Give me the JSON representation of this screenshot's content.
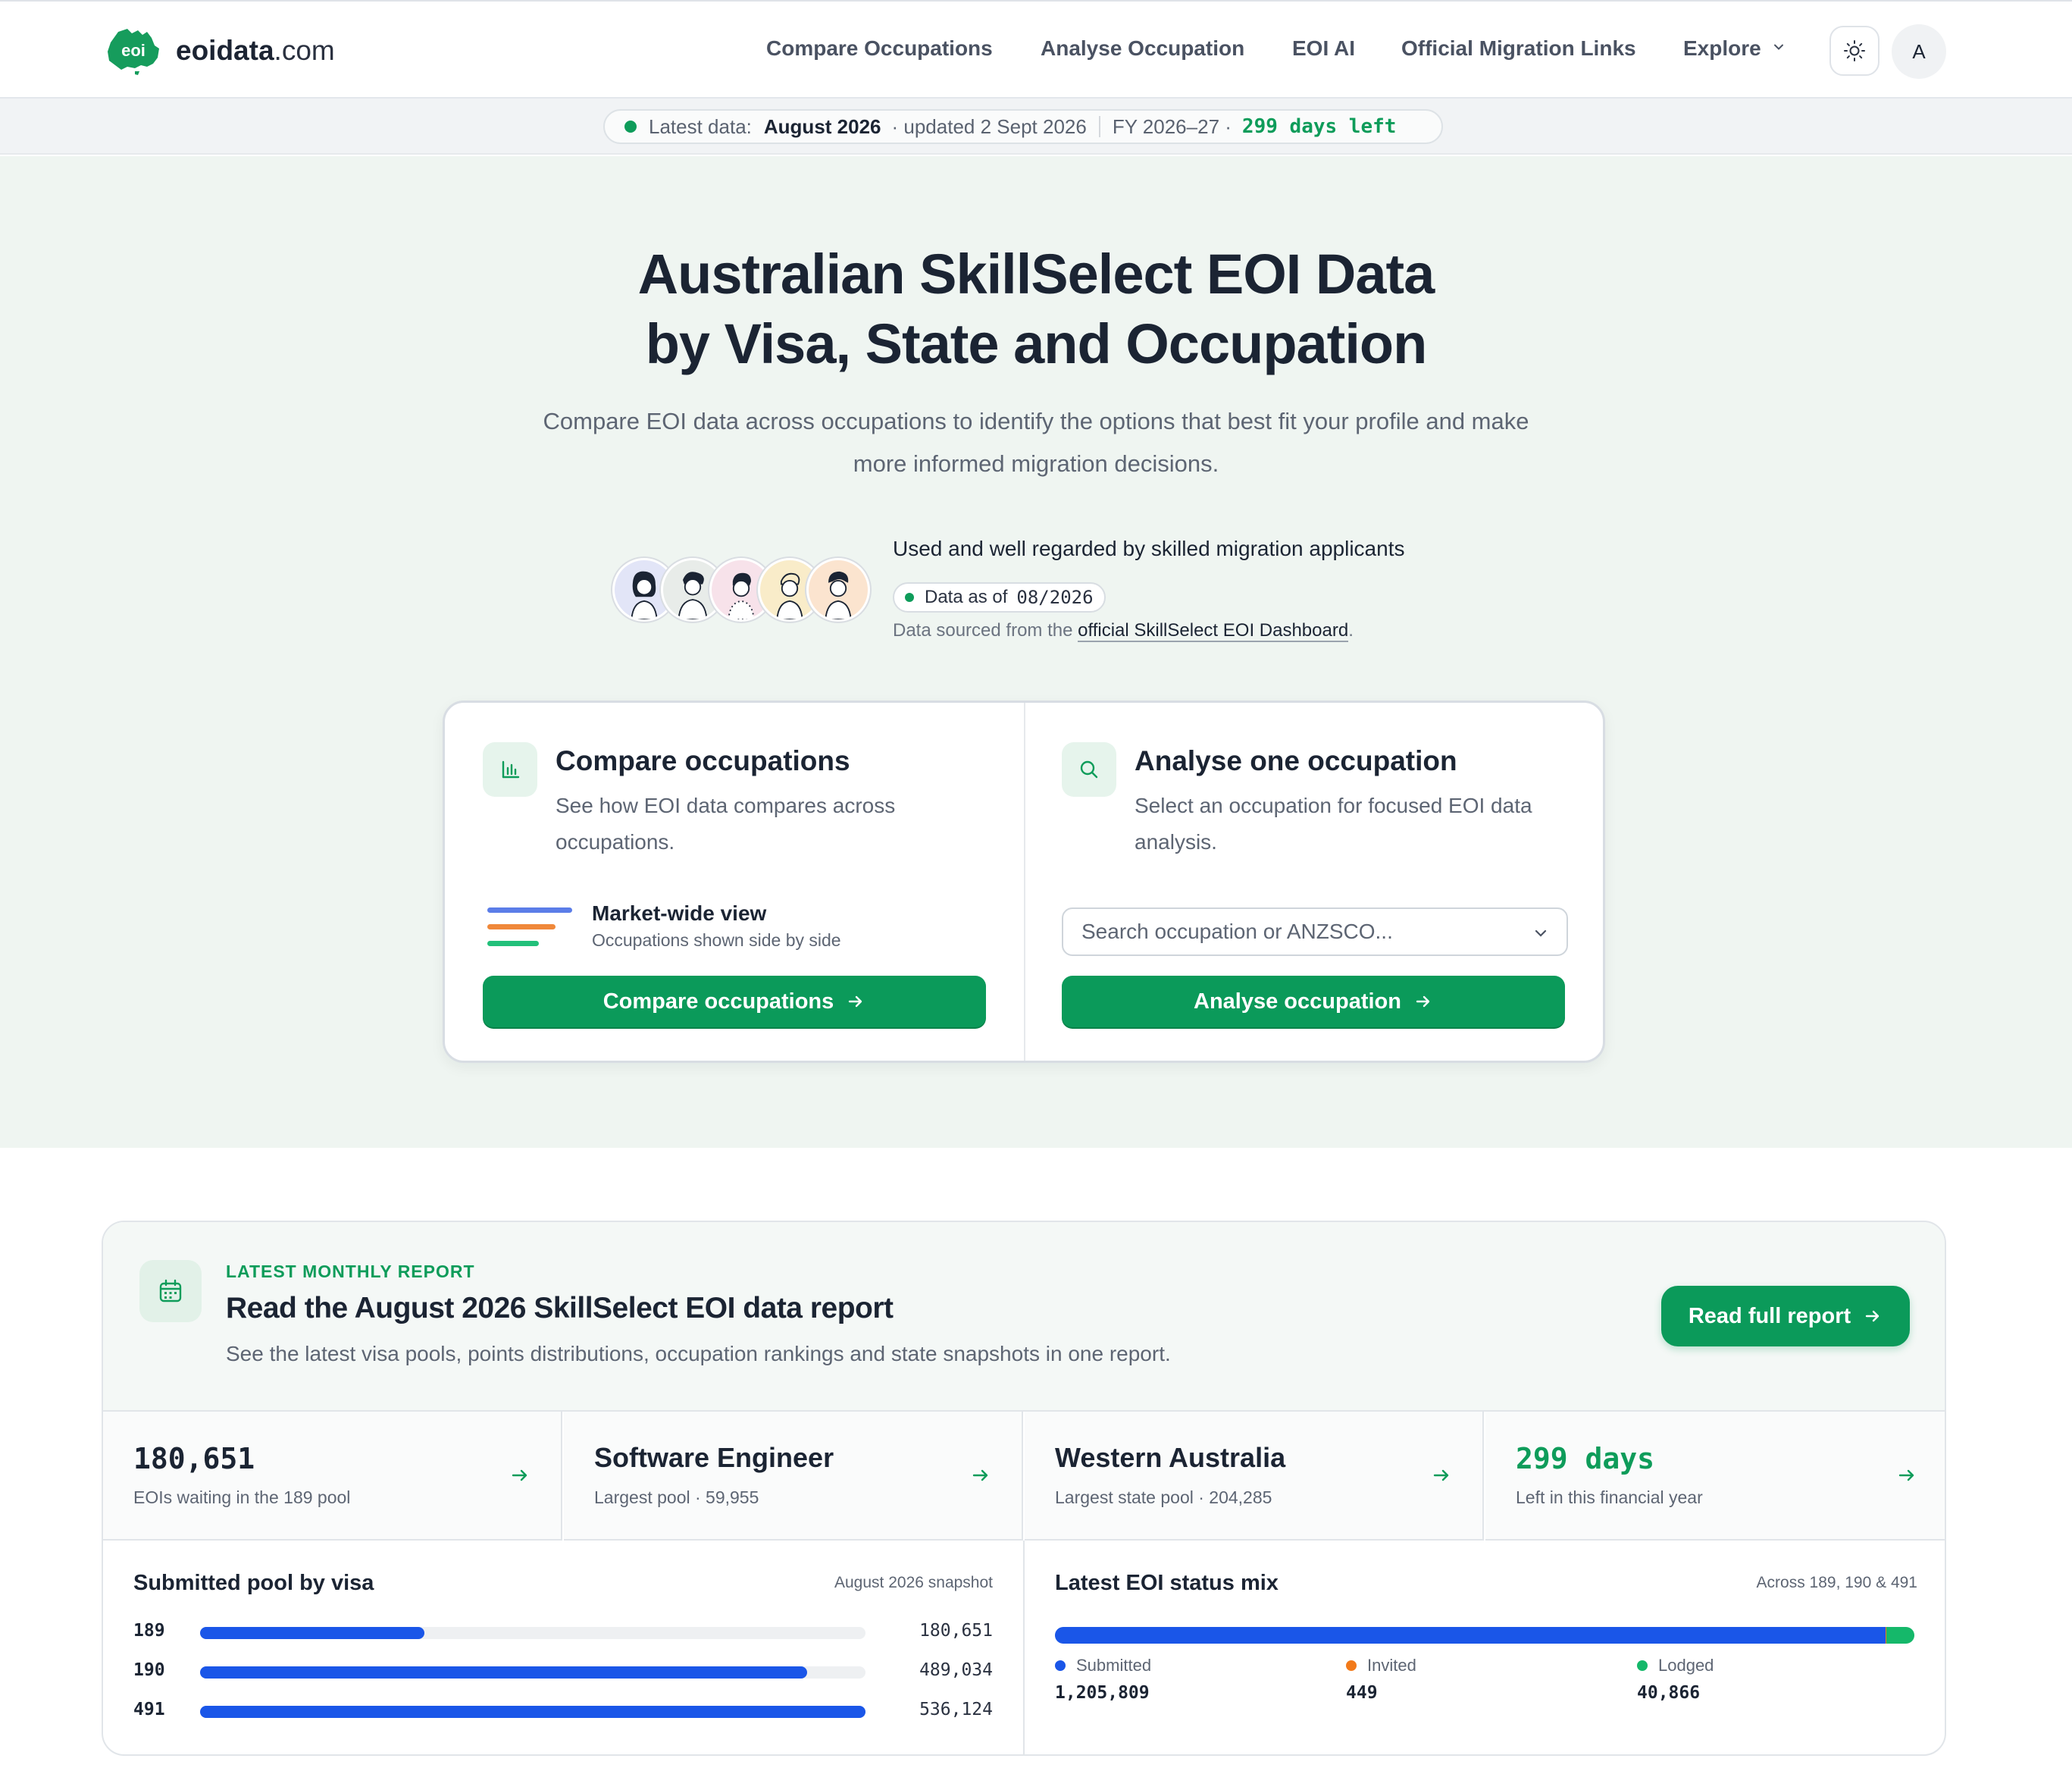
{
  "nav": {
    "logo_badge": "eoi",
    "logo_name": "eoidata",
    "logo_tld": ".com",
    "links": [
      "Compare Occupations",
      "Analyse Occupation",
      "EOI AI",
      "Official Migration Links",
      "Explore"
    ],
    "avatar_initial": "A"
  },
  "strip": {
    "label": "Latest data:",
    "month": "August 2026",
    "updated": "· updated 2 Sept 2026",
    "fy": "FY 2026–27 ·",
    "days_left": "299 days left"
  },
  "hero": {
    "title_line1": "Australian SkillSelect EOI Data",
    "title_line2": "by Visa, State and Occupation",
    "subtitle": "Compare EOI data across occupations to identify the options that best fit your profile and make more informed migration decisions.",
    "social_heading": "Used and well regarded by skilled migration applicants",
    "data_as_of_label": "Data as of",
    "data_as_of_value": "08/2026",
    "sourced_prefix": "Data sourced from the",
    "sourced_link": "official SkillSelect EOI Dashboard",
    "sourced_suffix": "."
  },
  "compare_card": {
    "title": "Compare occupations",
    "description": "See how EOI data compares across occupations.",
    "market_title": "Market-wide view",
    "market_sub": "Occupations shown side by side",
    "button": "Compare occupations"
  },
  "analyse_card": {
    "title": "Analyse one occupation",
    "description": "Select an occupation for focused EOI data analysis.",
    "search_placeholder": "Search occupation or ANZSCO...",
    "button": "Analyse occupation"
  },
  "report": {
    "kicker": "LATEST MONTHLY REPORT",
    "title": "Read the August 2026 SkillSelect EOI data report",
    "description": "See the latest visa pools, points distributions, occupation rankings and state snapshots in one report.",
    "button": "Read full report"
  },
  "stats": [
    {
      "main": "180,651",
      "sub": "EOIs waiting in the 189 pool"
    },
    {
      "main": "Software Engineer",
      "sub": "Largest pool · 59,955"
    },
    {
      "main": "Western Australia",
      "sub": "Largest state pool · 204,285"
    },
    {
      "main": "299 days",
      "sub": "Left in this financial year"
    }
  ],
  "pool_by_visa": {
    "title": "Submitted pool by visa",
    "note": "August 2026 snapshot",
    "rows": [
      {
        "visa": "189",
        "value": 180651,
        "display": "180,651"
      },
      {
        "visa": "190",
        "value": 489034,
        "display": "489,034"
      },
      {
        "visa": "491",
        "value": 536124,
        "display": "536,124"
      }
    ]
  },
  "status_mix": {
    "title": "Latest EOI status mix",
    "note": "Across 189, 190 & 491",
    "items": [
      {
        "label": "Submitted",
        "value": 1205809,
        "display": "1,205,809",
        "color": "#1a56e8"
      },
      {
        "label": "Invited",
        "value": 449,
        "display": "449",
        "color": "#f27a1a"
      },
      {
        "label": "Lodged",
        "value": 40866,
        "display": "40,866",
        "color": "#15b86a"
      }
    ]
  },
  "colors": {
    "brand_green": "#0b9a5a",
    "bar_blue": "#1a56e8",
    "hero_bg": "#eff5f1"
  }
}
